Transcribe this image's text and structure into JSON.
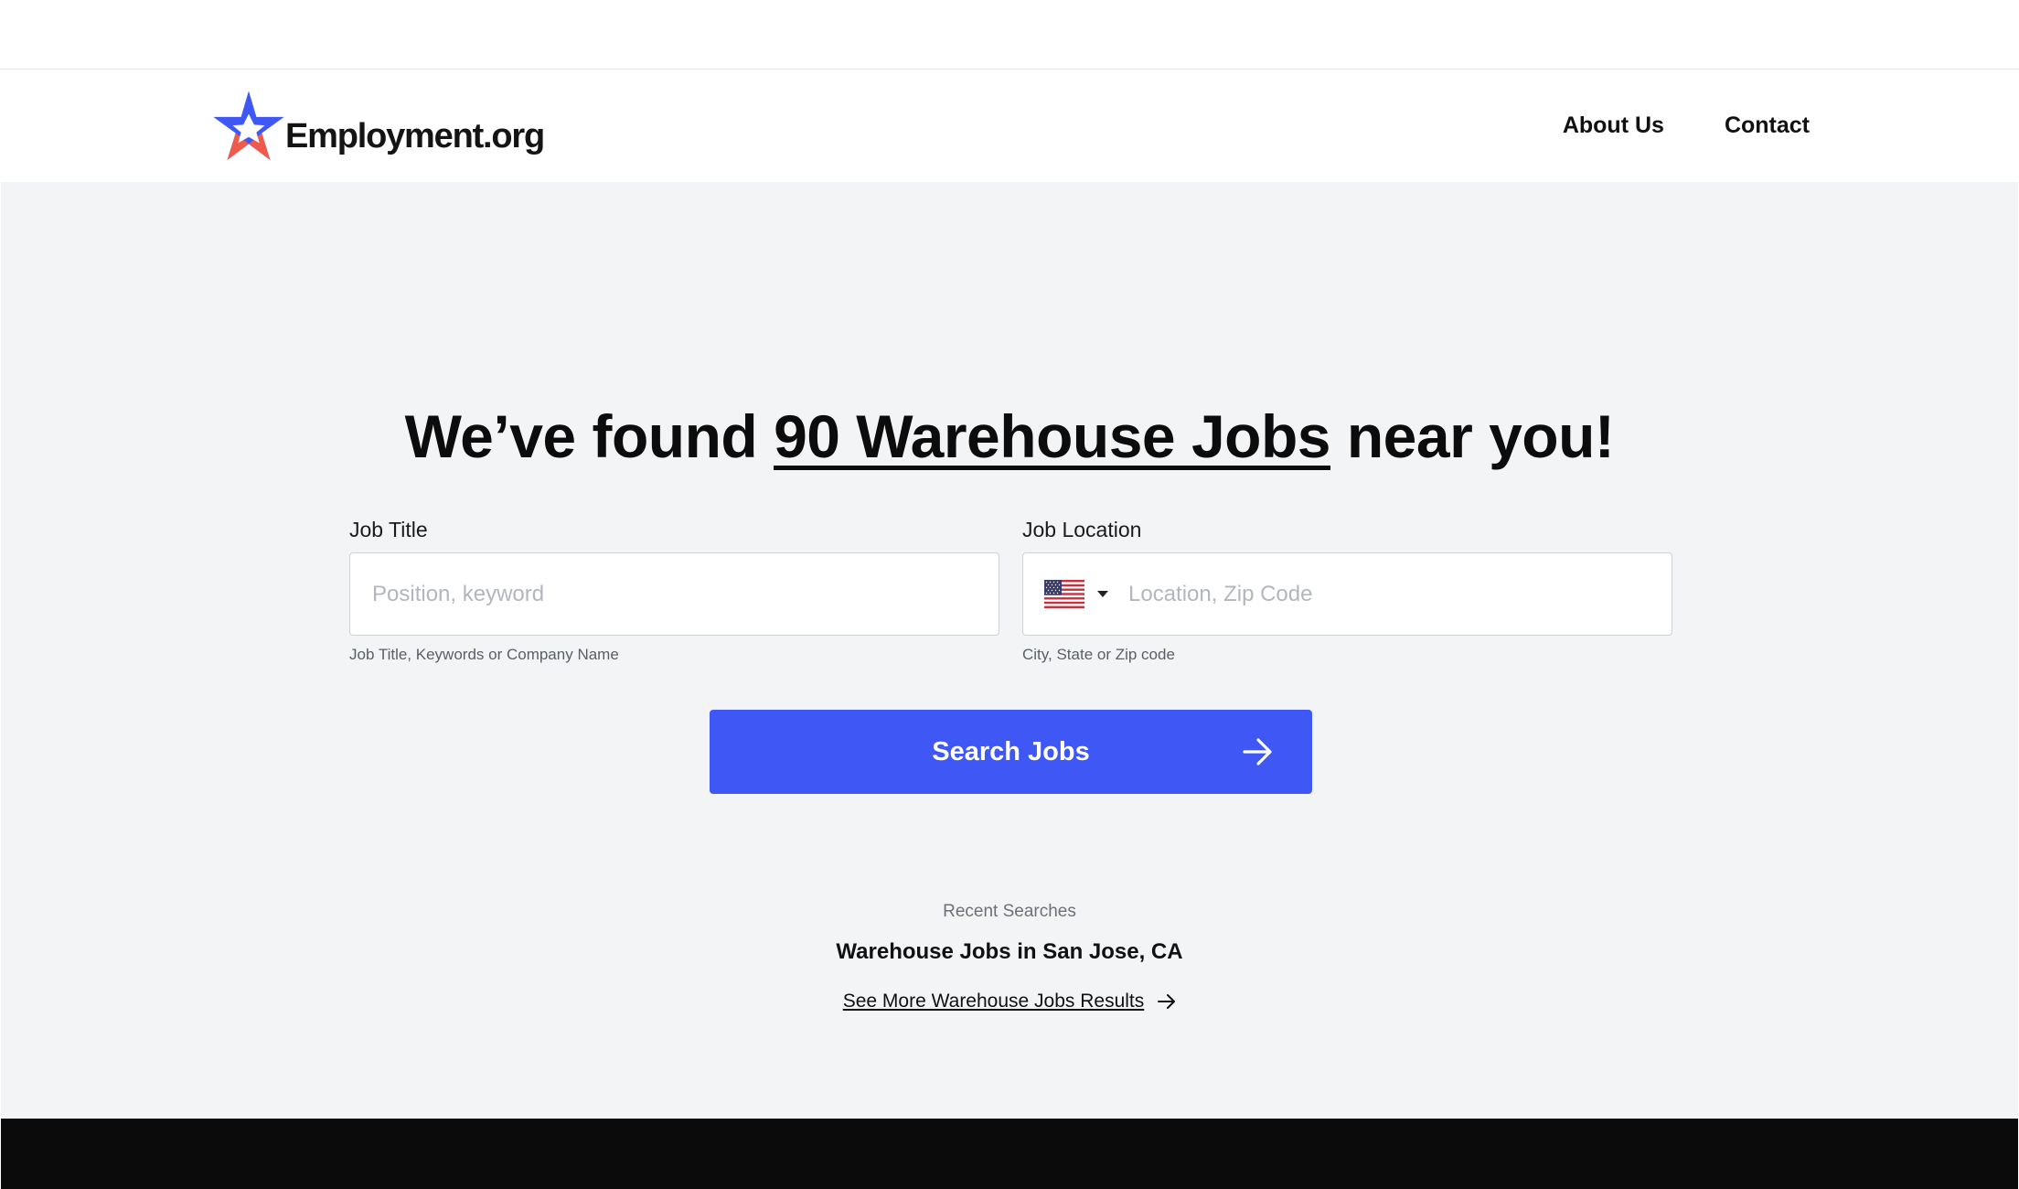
{
  "brand": {
    "name": "Employment.org",
    "logo_icon": "star-icon"
  },
  "nav": {
    "items": [
      {
        "label": "About Us"
      },
      {
        "label": "Contact"
      }
    ]
  },
  "hero": {
    "headline_prefix": "We’ve found ",
    "headline_highlight": "90 Warehouse Jobs",
    "headline_suffix": " near you!"
  },
  "search": {
    "job_title": {
      "label": "Job Title",
      "placeholder": "Position, keyword",
      "value": "",
      "hint": "Job Title, Keywords or Company Name"
    },
    "job_location": {
      "label": "Job Location",
      "country_icon": "us-flag-icon",
      "placeholder": "Location, Zip Code",
      "value": "",
      "hint": "City, State or Zip code"
    },
    "button_label": "Search Jobs"
  },
  "recent": {
    "title": "Recent Searches",
    "items": [
      {
        "label": "Warehouse Jobs in San Jose, CA"
      }
    ],
    "more_label": "See More Warehouse Jobs Results"
  },
  "colors": {
    "primary_button": "#3f57f5",
    "page_background": "#f3f4f6",
    "footer_background": "#0b0b0b",
    "logo_blue": "#3f57f5",
    "logo_red": "#ef5a4b"
  }
}
